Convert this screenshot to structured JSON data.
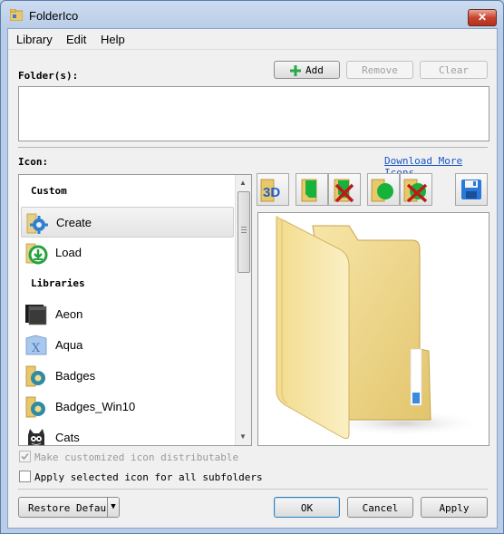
{
  "window": {
    "title": "FolderIco"
  },
  "menu": [
    "Library",
    "Edit",
    "Help"
  ],
  "folder_section": {
    "label": "Folder(s):",
    "add_label": "Add",
    "remove_label": "Remove",
    "clear_label": "Clear"
  },
  "icon_section": {
    "label": "Icon:",
    "download_link": "Download More Icons"
  },
  "list": {
    "custom_header": "Custom",
    "libraries_header": "Libraries",
    "custom_items": [
      "Create",
      "Load"
    ],
    "library_items": [
      "Aeon",
      "Aqua",
      "Badges",
      "Badges_Win10",
      "Cats"
    ]
  },
  "options": {
    "distributable_label": "Make customized icon distributable",
    "distributable_checked": true,
    "distributable_enabled": false,
    "subfolders_label": "Apply selected icon for all subfolders",
    "subfolders_checked": false
  },
  "footer": {
    "restore_label": "Restore Default",
    "ok_label": "OK",
    "cancel_label": "Cancel",
    "apply_label": "Apply"
  },
  "colors": {
    "accent_link": "#1a55c8",
    "folder": "#f2d98a",
    "green": "#2aa84a",
    "red": "#c0181a"
  }
}
